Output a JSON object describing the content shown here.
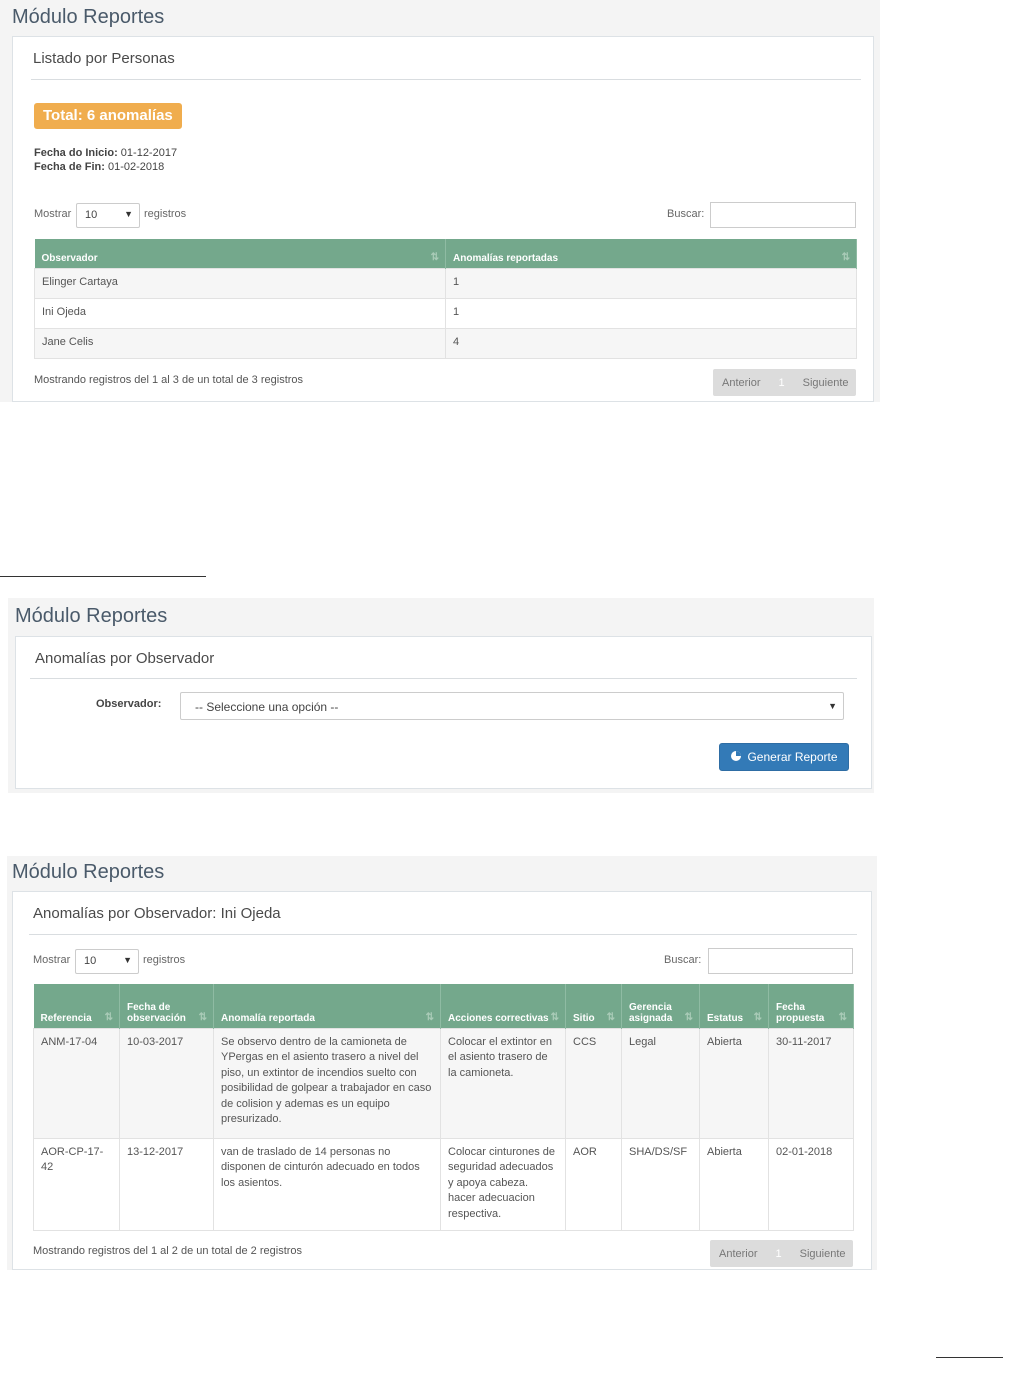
{
  "shot1": {
    "module_title": "Módulo Reportes",
    "panel_title": "Listado por Personas",
    "total_badge": "Total: 6 anomalías",
    "fecha_inicio_label": "Fecha do Inicio:",
    "fecha_inicio_value": "01-12-2017",
    "fecha_fin_label": "Fecha de Fin:",
    "fecha_fin_value": "01-02-2018",
    "mostrar_label": "Mostrar",
    "length_value": "10",
    "registros_label": "registros",
    "buscar_label": "Buscar:",
    "columns": [
      "Observador",
      "Anomalías reportadas"
    ],
    "rows": [
      [
        "Elinger Cartaya",
        "1"
      ],
      [
        "Ini Ojeda",
        "1"
      ],
      [
        "Jane Celis",
        "4"
      ]
    ],
    "info": "Mostrando registros del 1 al 3 de un total de 3 registros",
    "pager": {
      "prev": "Anterior",
      "page": "1",
      "next": "Siguiente"
    }
  },
  "shot2": {
    "module_title": "Módulo Reportes",
    "panel_title": "Anomalías por Observador",
    "observador_label": "Observador:",
    "select_value": "-- Seleccione una opción --",
    "button_label": "Generar Reporte",
    "button_icon": "pie-chart-icon"
  },
  "shot3": {
    "module_title": "Módulo Reportes",
    "panel_title": "Anomalías por Observador: Ini Ojeda",
    "mostrar_label": "Mostrar",
    "length_value": "10",
    "registros_label": "registros",
    "buscar_label": "Buscar:",
    "columns": [
      "Referencia",
      "Fecha de observación",
      "Anomalía reportada",
      "Acciones correctivas",
      "Sitio",
      "Gerencia asignada",
      "Estatus",
      "Fecha propuesta"
    ],
    "rows": [
      [
        "ANM-17-04",
        "10-03-2017",
        "Se observo dentro de la camioneta de YPergas en el asiento trasero a nivel del piso, un extintor de incendios suelto con posibilidad de golpear a trabajador en caso de colision y ademas es un equipo presurizado.",
        "Colocar el extintor en el asiento trasero de la camioneta.",
        "CCS",
        "Legal",
        "Abierta",
        "30-11-2017"
      ],
      [
        "AOR-CP-17-42",
        "13-12-2017",
        "van de traslado de 14 personas no disponen de cinturón adecuado en todos los asientos.",
        "Colocar cinturones de seguridad adecuados y apoya cabeza. hacer adecuacion respectiva.",
        "AOR",
        "SHA/DS/SF",
        "Abierta",
        "02-01-2018"
      ]
    ],
    "info": "Mostrando registros del 1 al 2 de un total de 2 registros",
    "pager": {
      "prev": "Anterior",
      "page": "1",
      "next": "Siguiente"
    }
  }
}
